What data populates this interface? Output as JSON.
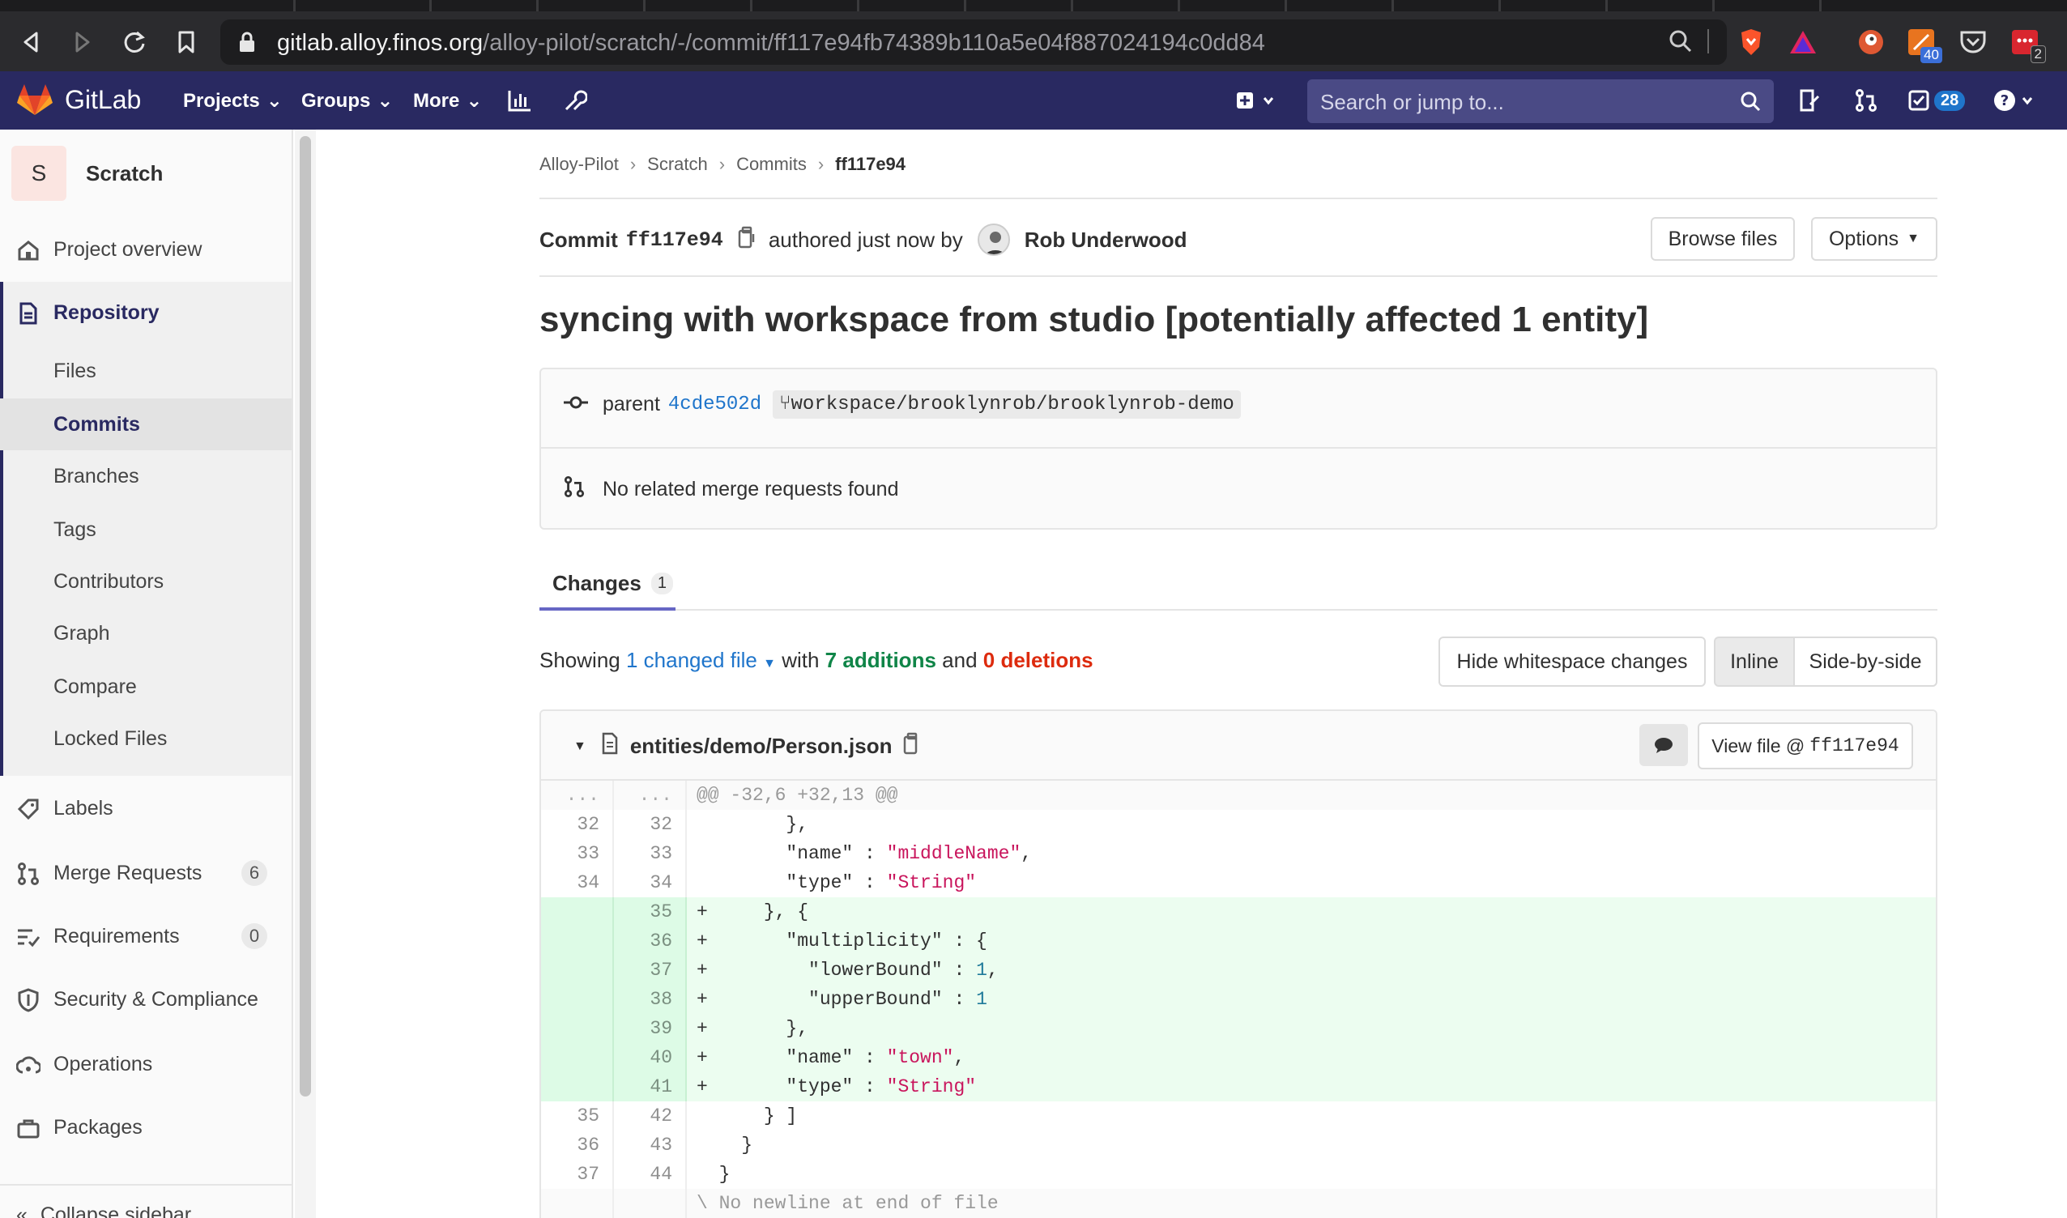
{
  "browser": {
    "url_host": "gitlab.alloy.finos.org",
    "url_path": "/alloy-pilot/scratch/-/commit/ff117e94fb74389b110a5e04f887024194c0dd84",
    "ext_badges": [
      "40",
      "2"
    ]
  },
  "header": {
    "logo_text": "GitLab",
    "projects": "Projects",
    "groups": "Groups",
    "more": "More",
    "search_placeholder": "Search or jump to...",
    "todos_count": "28"
  },
  "sidebar": {
    "project_initial": "S",
    "project_name": "Scratch",
    "overview": "Project overview",
    "repository": "Repository",
    "repo_items": [
      "Files",
      "Commits",
      "Branches",
      "Tags",
      "Contributors",
      "Graph",
      "Compare",
      "Locked Files"
    ],
    "labels": "Labels",
    "merge_requests": "Merge Requests",
    "merge_requests_count": "6",
    "requirements": "Requirements",
    "requirements_count": "0",
    "security": "Security & Compliance",
    "operations": "Operations",
    "packages": "Packages",
    "collapse": "Collapse sidebar"
  },
  "breadcrumb": [
    "Alloy-Pilot",
    "Scratch",
    "Commits",
    "ff117e94"
  ],
  "commit": {
    "label": "Commit",
    "short_sha": "ff117e94",
    "authored": "authored just now by",
    "author": "Rob Underwood",
    "browse_files": "Browse files",
    "options": "Options",
    "title": "syncing with workspace from studio [potentially affected 1 entity]",
    "parent_label": "parent",
    "parent_sha": "4cde502d",
    "branch": "workspace/brooklynrob/brooklynrob-demo",
    "no_mr": "No related merge requests found"
  },
  "tabs": {
    "changes": "Changes",
    "changes_count": "1"
  },
  "summary": {
    "showing": "Showing",
    "changed_files": "1 changed file",
    "with": "with",
    "additions": "7 additions",
    "and": "and",
    "deletions": "0 deletions",
    "hide_ws": "Hide whitespace changes",
    "inline": "Inline",
    "side_by_side": "Side-by-side"
  },
  "diff": {
    "file_path": "entities/demo/Person.json",
    "view_file": "View file @",
    "view_file_sha": "ff117e94",
    "hunk": "@@ -32,6 +32,13 @@",
    "no_newline": "\\ No newline at end of file"
  },
  "colors": {
    "header_bg": "#292961",
    "link": "#1f75cb",
    "addition": "#108548",
    "deletion": "#dd2b0e",
    "added_line_bg": "#ecfdf0"
  }
}
